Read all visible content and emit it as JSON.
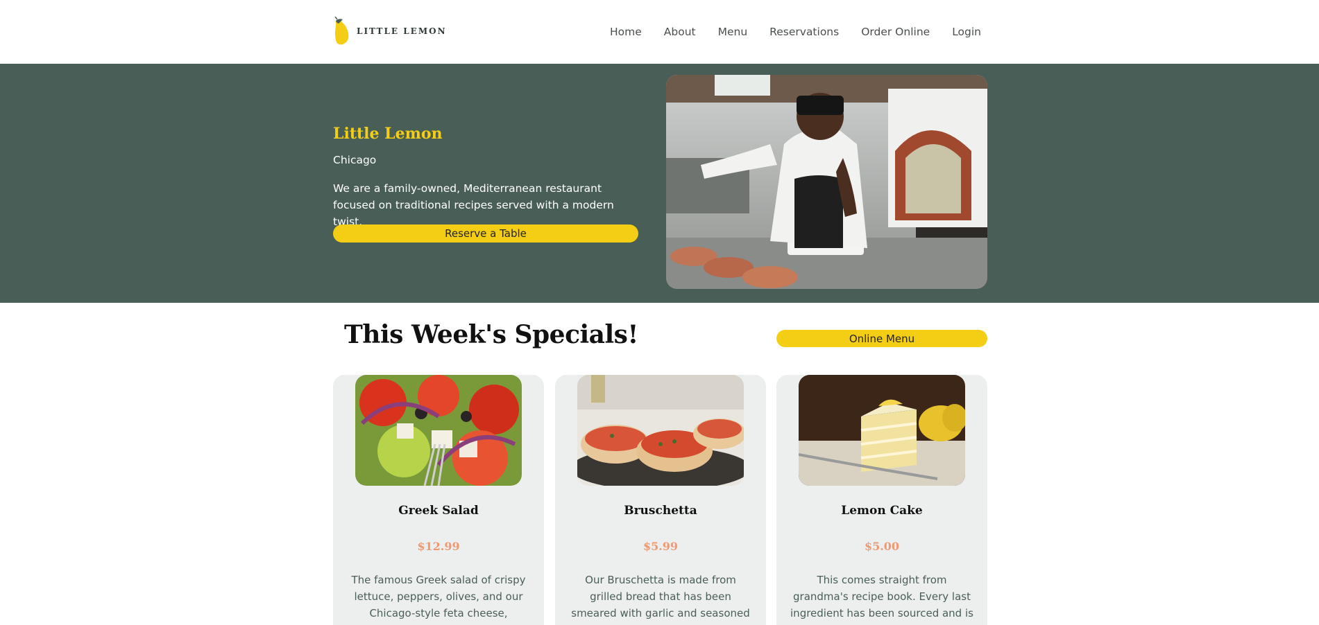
{
  "brand": {
    "logo_text": "LITTLE LEMON"
  },
  "nav": {
    "items": [
      {
        "label": "Home"
      },
      {
        "label": "About"
      },
      {
        "label": "Menu"
      },
      {
        "label": "Reservations"
      },
      {
        "label": "Order Online"
      },
      {
        "label": "Login"
      }
    ]
  },
  "hero": {
    "title": "Little Lemon",
    "city": "Chicago",
    "description": "We are a family-owned, Mediterranean restaurant focused on traditional recipes served with a modern twist.",
    "button_label": "Reserve a Table"
  },
  "specials": {
    "title": "This Week's Specials!",
    "menu_button_label": "Online Menu",
    "cards": [
      {
        "title": "Greek Salad",
        "price": "$12.99",
        "description": "The famous Greek salad of crispy lettuce, peppers, olives, and our Chicago-style feta cheese, garnished"
      },
      {
        "title": "Bruschetta",
        "price": "$5.99",
        "description": "Our Bruschetta is made from grilled bread that has been smeared with garlic and seasoned with salt and"
      },
      {
        "title": "Lemon Cake",
        "price": "$5.00",
        "description": "This comes straight from grandma's recipe book. Every last ingredient has been sourced and is authentic as"
      }
    ]
  },
  "colors": {
    "primary_green": "#495e57",
    "primary_yellow": "#f4ce14",
    "price_salmon": "#ee9972",
    "card_bg": "#edefee"
  }
}
